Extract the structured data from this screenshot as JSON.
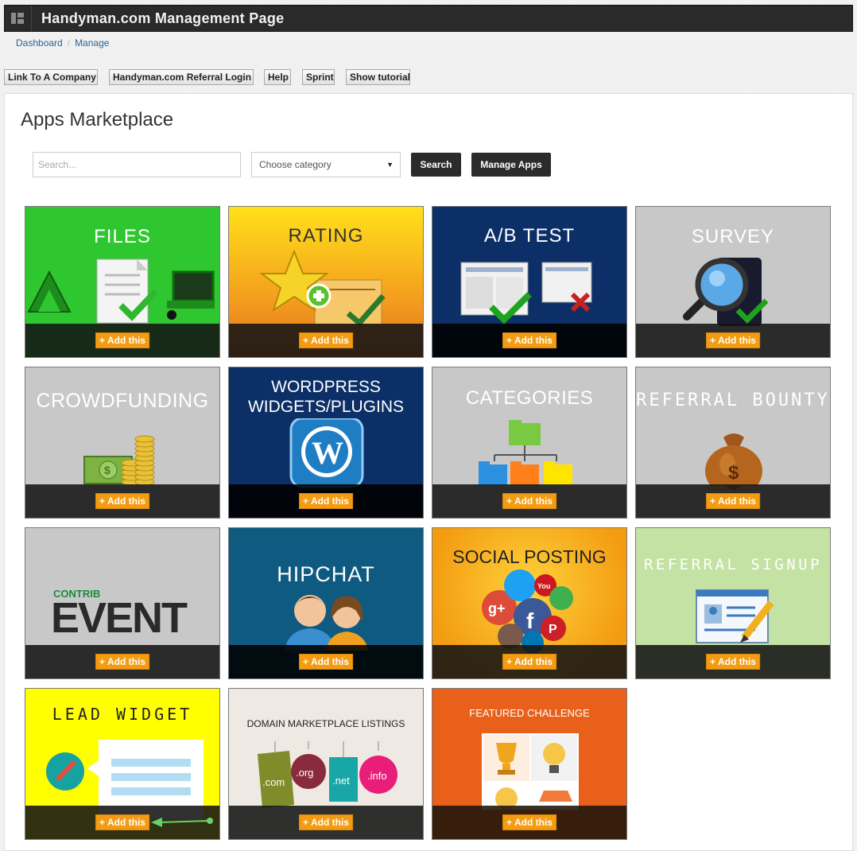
{
  "header": {
    "title": "Handyman.com Management Page"
  },
  "breadcrumb": {
    "items": [
      "Dashboard",
      "Manage"
    ]
  },
  "links": [
    "Link To A Company",
    "Handyman.com Referral Login",
    "Help",
    "Sprint",
    "Show tutorial"
  ],
  "marketplace": {
    "heading": "Apps Marketplace",
    "search_placeholder": "Search...",
    "category_selected": "Choose category",
    "search_button": "Search",
    "manage_button": "Manage Apps",
    "add_label": "+ Add this"
  },
  "apps": [
    {
      "title": "FILES",
      "bg": "#2ecc2e"
    },
    {
      "title": "RATING",
      "bg": "#f7a31c"
    },
    {
      "title": "A/B TEST",
      "bg": "#0b2f66"
    },
    {
      "title": "SURVEY",
      "bg": "#c8c8c8"
    },
    {
      "title": "CROWDFUNDING",
      "bg": "#c8c8c8"
    },
    {
      "title": "WORDPRESS WIDGETS/PLUGINS",
      "bg": "#0b2f66"
    },
    {
      "title": "CATEGORIES",
      "bg": "#c8c8c8"
    },
    {
      "title": "REFERRAL BOUNTY",
      "bg": "#c8c8c8"
    },
    {
      "title": "EVENT",
      "subtitle": "CONTRIB",
      "bg": "#c8c8c8"
    },
    {
      "title": "HIPCHAT",
      "bg": "#0e5a80"
    },
    {
      "title": "SOCIAL POSTING",
      "bg": "#f7a31c"
    },
    {
      "title": "REFERRAL SIGNUP",
      "bg": "#c4e2a4"
    },
    {
      "title": "LEAD WIDGET",
      "bg": "#ffff00"
    },
    {
      "title": "DOMAIN MARKETPLACE LISTINGS",
      "bg": "#efe9e3"
    },
    {
      "title": "FEATURED CHALLENGE",
      "bg": "#e8601a"
    }
  ],
  "domain_tags": [
    ".com",
    ".org",
    ".net",
    ".info"
  ]
}
